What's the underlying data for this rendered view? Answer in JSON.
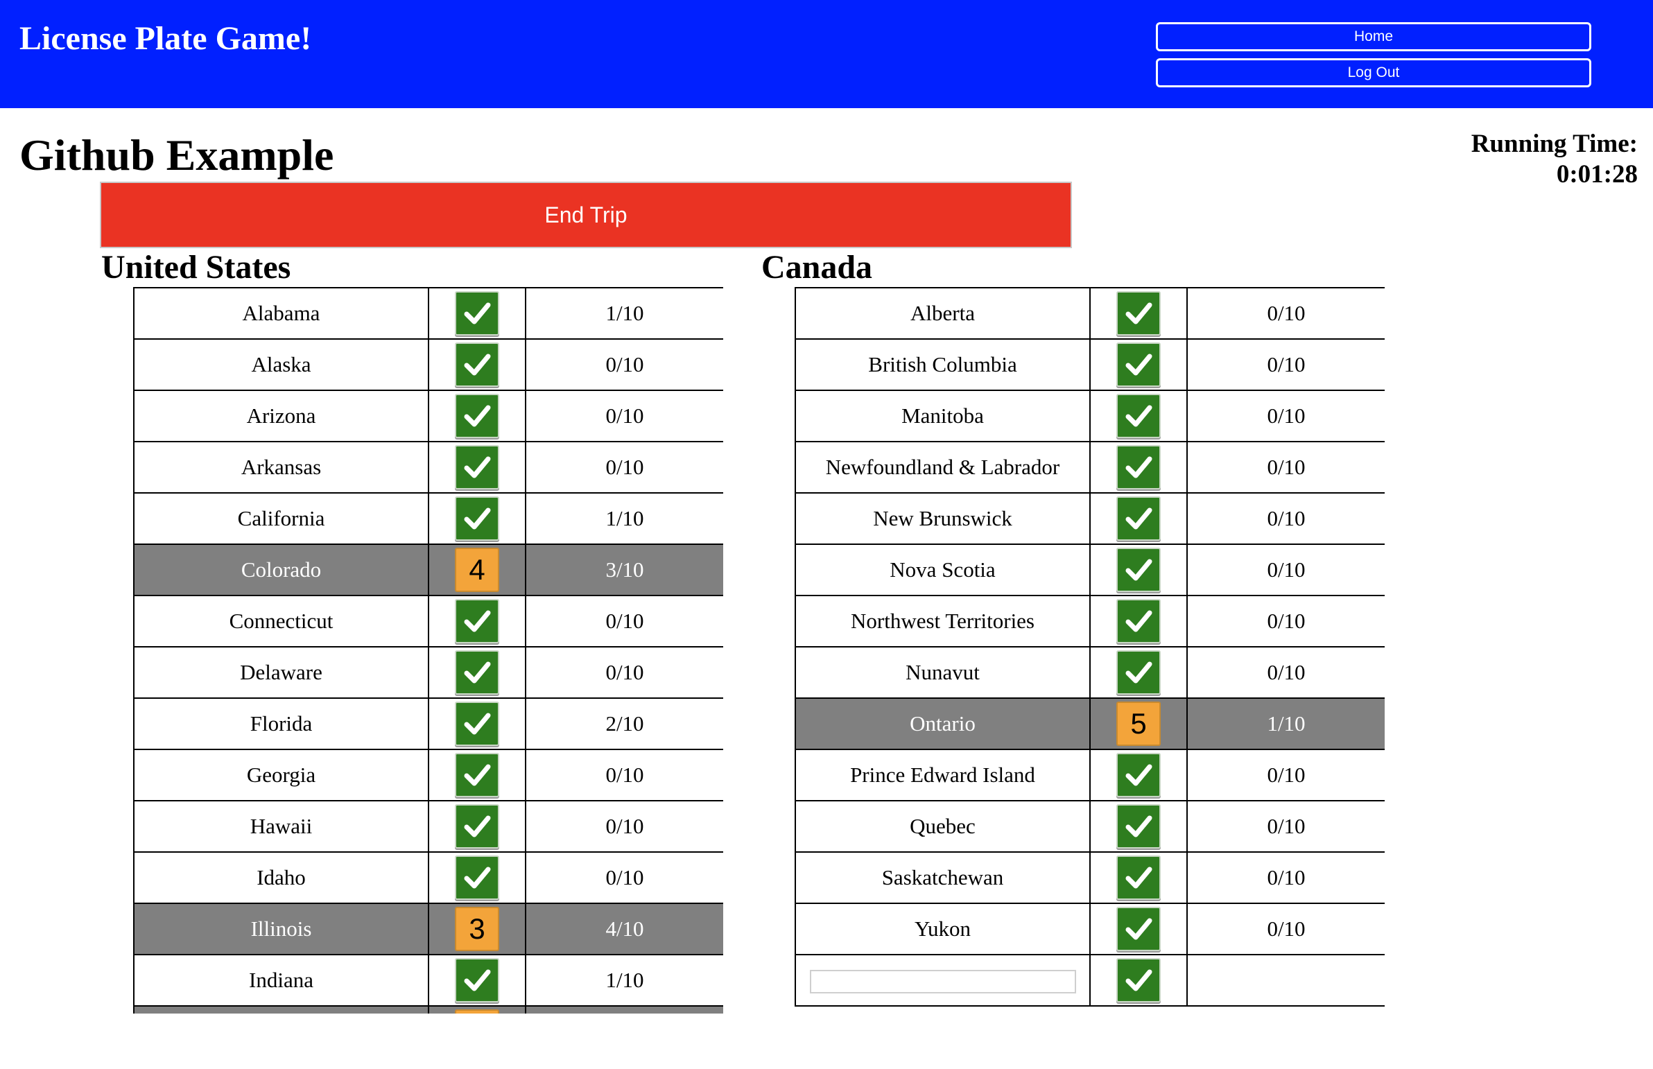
{
  "header": {
    "title": "License Plate Game!",
    "home_label": "Home",
    "logout_label": "Log Out"
  },
  "trip": {
    "title": "Github Example",
    "running_label": "Running Time:",
    "running_time": "0:01:28",
    "end_trip_label": "End Trip"
  },
  "us": {
    "heading": "United States",
    "rows": [
      {
        "name": "Alabama",
        "mark": "check",
        "count": "1/10"
      },
      {
        "name": "Alaska",
        "mark": "check",
        "count": "0/10"
      },
      {
        "name": "Arizona",
        "mark": "check",
        "count": "0/10"
      },
      {
        "name": "Arkansas",
        "mark": "check",
        "count": "0/10"
      },
      {
        "name": "California",
        "mark": "check",
        "count": "1/10"
      },
      {
        "name": "Colorado",
        "mark": "4",
        "count": "3/10",
        "highlight": true
      },
      {
        "name": "Connecticut",
        "mark": "check",
        "count": "0/10"
      },
      {
        "name": "Delaware",
        "mark": "check",
        "count": "0/10"
      },
      {
        "name": "Florida",
        "mark": "check",
        "count": "2/10"
      },
      {
        "name": "Georgia",
        "mark": "check",
        "count": "0/10"
      },
      {
        "name": "Hawaii",
        "mark": "check",
        "count": "0/10"
      },
      {
        "name": "Idaho",
        "mark": "check",
        "count": "0/10"
      },
      {
        "name": "Illinois",
        "mark": "3",
        "count": "4/10",
        "highlight": true
      },
      {
        "name": "Indiana",
        "mark": "check",
        "count": "1/10"
      },
      {
        "name": "",
        "mark": "",
        "count": "",
        "highlight": true
      }
    ]
  },
  "canada": {
    "heading": "Canada",
    "rows": [
      {
        "name": "Alberta",
        "mark": "check",
        "count": "0/10"
      },
      {
        "name": "British Columbia",
        "mark": "check",
        "count": "0/10"
      },
      {
        "name": "Manitoba",
        "mark": "check",
        "count": "0/10"
      },
      {
        "name": "Newfoundland & Labrador",
        "mark": "check",
        "count": "0/10"
      },
      {
        "name": "New Brunswick",
        "mark": "check",
        "count": "0/10"
      },
      {
        "name": "Nova Scotia",
        "mark": "check",
        "count": "0/10"
      },
      {
        "name": "Northwest Territories",
        "mark": "check",
        "count": "0/10"
      },
      {
        "name": "Nunavut",
        "mark": "check",
        "count": "0/10"
      },
      {
        "name": "Ontario",
        "mark": "5",
        "count": "1/10",
        "highlight": true
      },
      {
        "name": "Prince Edward Island",
        "mark": "check",
        "count": "0/10"
      },
      {
        "name": "Quebec",
        "mark": "check",
        "count": "0/10"
      },
      {
        "name": "Saskatchewan",
        "mark": "check",
        "count": "0/10"
      },
      {
        "name": "Yukon",
        "mark": "check",
        "count": "0/10"
      },
      {
        "name": "",
        "mark": "check",
        "count": "",
        "input": true
      }
    ]
  },
  "colors": {
    "header_bg": "#0120ff",
    "end_trip_bg": "#ea3323",
    "check_bg": "#2e7d1f",
    "count_badge_bg": "#f3a43a",
    "highlight_row_bg": "#808080"
  },
  "icons": {
    "check": "checkmark-icon"
  }
}
